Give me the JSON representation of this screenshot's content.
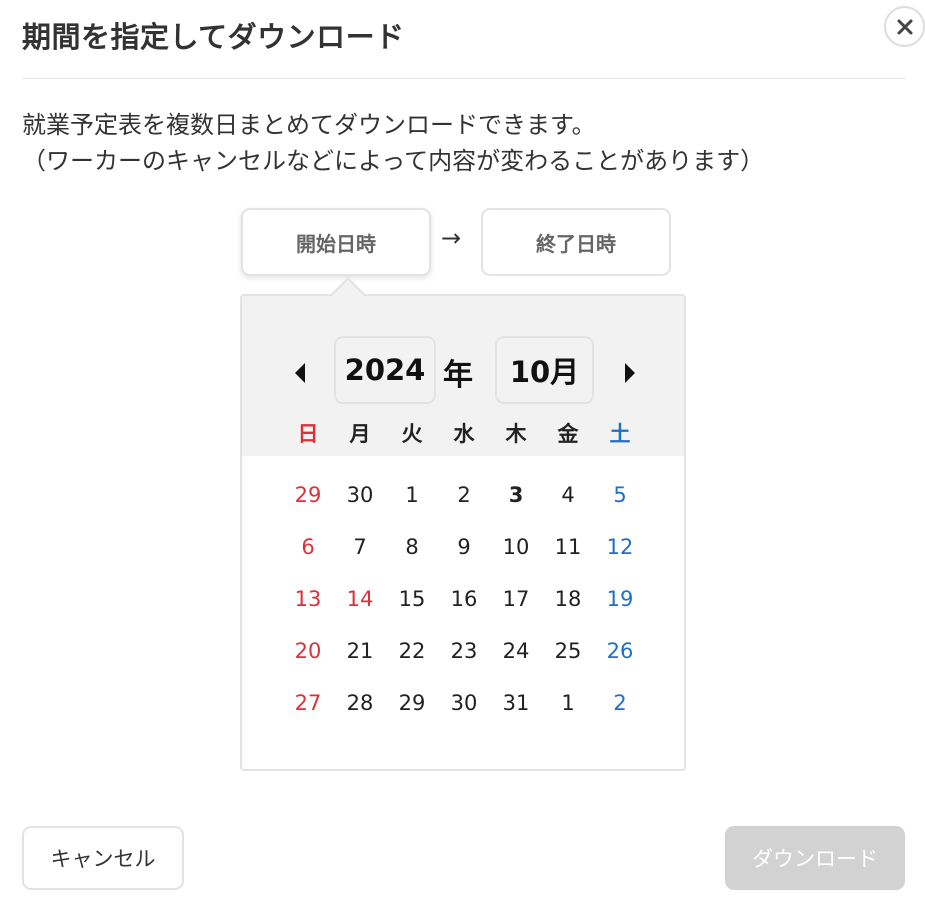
{
  "dialog": {
    "title": "期間を指定してダウンロード",
    "close_icon": "close-icon",
    "description_line1": "就業予定表を複数日まとめてダウンロードできます。",
    "description_line2": "（ワーカーのキャンセルなどによって内容が変わることがあります）"
  },
  "range": {
    "start_label": "開始日時",
    "arrow": "→",
    "end_label": "終了日時"
  },
  "calendar": {
    "year": "2024",
    "year_unit": "年",
    "month": "10月",
    "prev_icon": "triangle-left-icon",
    "next_icon": "triangle-right-icon",
    "weekdays": [
      "日",
      "月",
      "火",
      "水",
      "木",
      "金",
      "土"
    ],
    "today": "3",
    "holidays": [
      "14"
    ],
    "weeks": [
      [
        "29",
        "30",
        "1",
        "2",
        "3",
        "4",
        "5"
      ],
      [
        "6",
        "7",
        "8",
        "9",
        "10",
        "11",
        "12"
      ],
      [
        "13",
        "14",
        "15",
        "16",
        "17",
        "18",
        "19"
      ],
      [
        "20",
        "21",
        "22",
        "23",
        "24",
        "25",
        "26"
      ],
      [
        "27",
        "28",
        "29",
        "30",
        "31",
        "1",
        "2"
      ]
    ]
  },
  "footer": {
    "cancel_label": "キャンセル",
    "download_label": "ダウンロード"
  },
  "colors": {
    "sunday": "#d8333a",
    "saturday": "#1f6fc5",
    "disabled_button": "#d2d2d2",
    "header_bg": "#f2f2f2"
  }
}
